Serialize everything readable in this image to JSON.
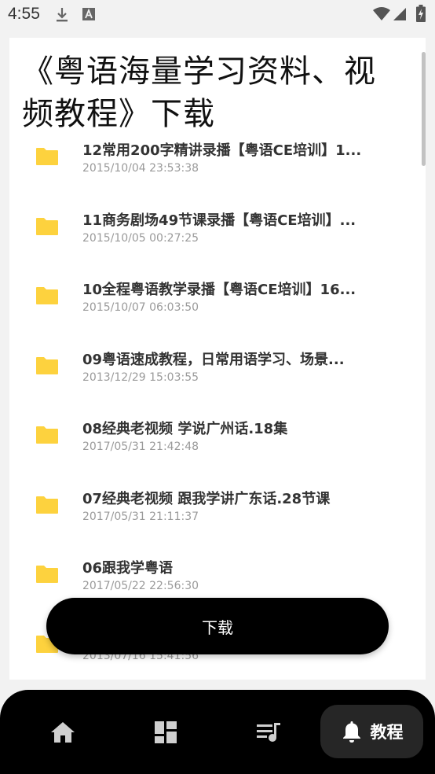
{
  "status_bar": {
    "time": "4:55",
    "icons": [
      "download-icon",
      "a-box-icon",
      "wifi-icon",
      "signal-icon",
      "battery-charging-icon"
    ]
  },
  "page": {
    "title": "《粤语海量学习资料、视频教程》下载"
  },
  "files": [
    {
      "name": "12常用200字精讲录播【粤语CE培训】1...",
      "date": "2015/10/04 23:53:38"
    },
    {
      "name": "11商务剧场49节课录播【粤语CE培训】...",
      "date": "2015/10/05 00:27:25"
    },
    {
      "name": "10全程粤语教学录播【粤语CE培训】16...",
      "date": "2015/10/07 06:03:50"
    },
    {
      "name": "09粤语速成教程，日常用语学习、场景...",
      "date": "2013/12/29 15:03:55"
    },
    {
      "name": "08经典老视频 学说广州话.18集",
      "date": "2017/05/31 21:42:48"
    },
    {
      "name": "07经典老视频 跟我学讲广东话.28节课",
      "date": "2017/05/31 21:11:37"
    },
    {
      "name": "06跟我学粤语",
      "date": "2017/05/22 22:56:30"
    },
    {
      "name": "",
      "date": "2013/07/16 15:41:56"
    }
  ],
  "download_button": {
    "label": "下载"
  },
  "nav": {
    "items": [
      {
        "icon": "home-icon"
      },
      {
        "icon": "dashboard-icon"
      },
      {
        "icon": "playlist-music-icon"
      },
      {
        "icon": "bell-icon",
        "label": "教程",
        "active": true
      }
    ]
  },
  "colors": {
    "folder": "#FDD23E",
    "background": "#F2F2F2",
    "nav_background": "#000000",
    "nav_active": "#262626"
  }
}
